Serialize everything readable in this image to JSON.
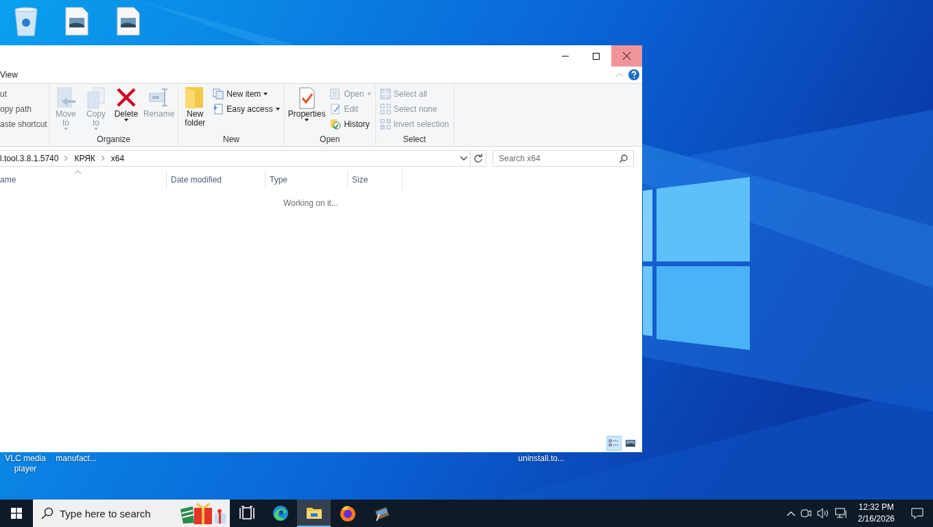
{
  "desktop": {
    "icons": [
      {
        "label": "VLC media player"
      },
      {
        "label": "manufact..."
      },
      {
        "label": "uninstall.to..."
      }
    ]
  },
  "window": {
    "tab": "View",
    "clipboard": [
      {
        "label": "ut",
        "disabled": false
      },
      {
        "label": "opy path",
        "disabled": false
      },
      {
        "label": "aste shortcut",
        "disabled": false
      }
    ],
    "groups": [
      {
        "label": "Organize",
        "items": [
          {
            "kind": "large",
            "lines": [
              "Move",
              "to"
            ],
            "dropdown": true,
            "disabled": true
          },
          {
            "kind": "large",
            "lines": [
              "Copy",
              "to"
            ],
            "dropdown": true,
            "disabled": true
          },
          {
            "kind": "large",
            "lines": [
              "Delete"
            ],
            "dropdown": true,
            "disabled": false
          },
          {
            "kind": "large",
            "lines": [
              "Rename"
            ],
            "dropdown": false,
            "disabled": true
          }
        ]
      },
      {
        "label": "New",
        "items": [
          {
            "kind": "large",
            "lines": [
              "New",
              "folder"
            ],
            "dropdown": false,
            "disabled": false
          },
          {
            "kind": "small",
            "lines": [
              "New item"
            ],
            "dropdown": true,
            "disabled": false
          },
          {
            "kind": "small",
            "lines": [
              "Easy access"
            ],
            "dropdown": true,
            "disabled": false
          }
        ]
      },
      {
        "label": "Open",
        "items": [
          {
            "kind": "large",
            "lines": [
              "Properties"
            ],
            "dropdown": true,
            "disabled": false
          },
          {
            "kind": "small",
            "lines": [
              "Open"
            ],
            "dropdown": true,
            "disabled": true
          },
          {
            "kind": "small",
            "lines": [
              "Edit"
            ],
            "dropdown": false,
            "disabled": true
          },
          {
            "kind": "small",
            "lines": [
              "History"
            ],
            "dropdown": false,
            "disabled": false
          }
        ]
      },
      {
        "label": "Select",
        "items": [
          {
            "kind": "small",
            "lines": [
              "Select all"
            ],
            "dropdown": false,
            "disabled": true
          },
          {
            "kind": "small",
            "lines": [
              "Select none"
            ],
            "dropdown": false,
            "disabled": true
          },
          {
            "kind": "small",
            "lines": [
              "Invert selection"
            ],
            "dropdown": false,
            "disabled": true
          }
        ]
      }
    ],
    "path": [
      "l.tool.3.8.1.5740",
      "КРЯК",
      "x64"
    ],
    "search": {
      "placeholder": "Search x64"
    },
    "columns": [
      "ame",
      "Date modified",
      "Type",
      "Size"
    ],
    "status": "Working on it...",
    "views": [
      {
        "selected": true
      },
      {
        "selected": false
      }
    ]
  },
  "taskbar": {
    "search": {
      "placeholder": "Type here to search"
    },
    "apps": [
      {
        "selected": false
      },
      {
        "selected": false
      },
      {
        "selected": true
      },
      {
        "selected": false
      },
      {
        "selected": false
      }
    ],
    "time": "12:32 PM",
    "date": "2/16/2026"
  }
}
